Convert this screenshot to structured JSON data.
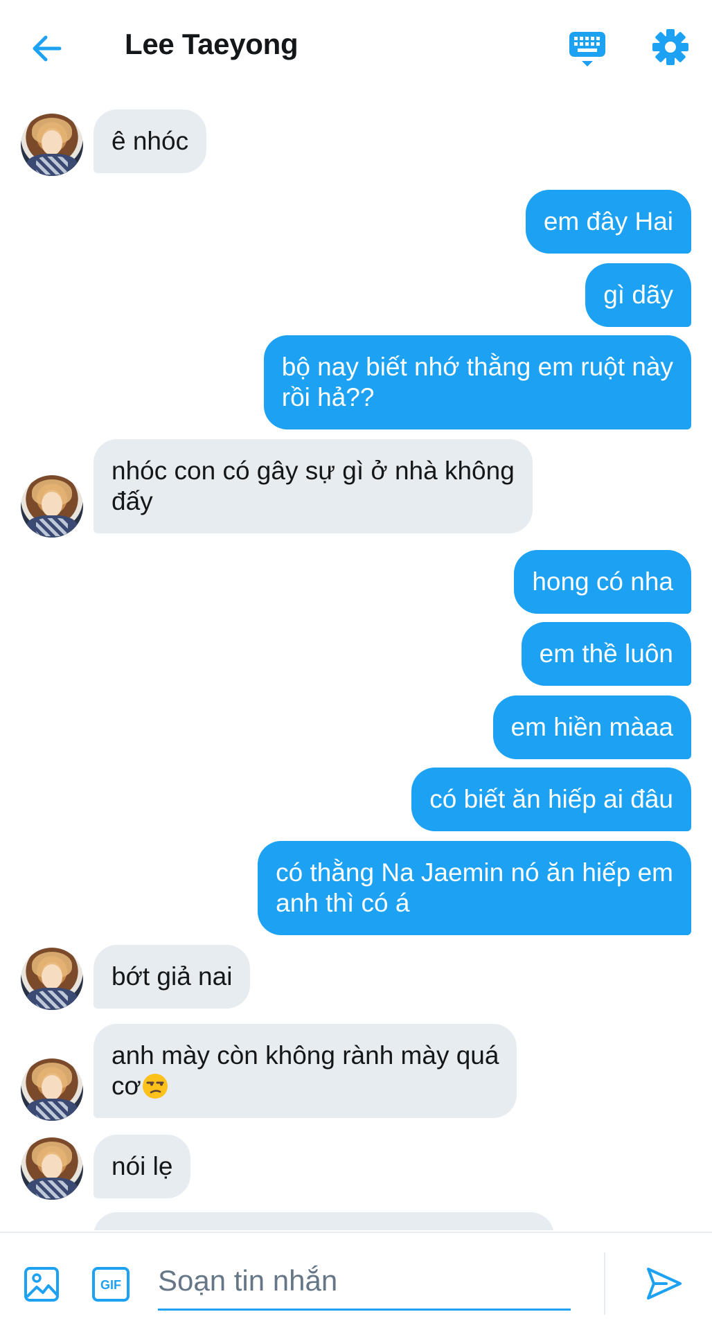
{
  "header": {
    "title": "Lee Taeyong",
    "back_icon": "arrow-left-icon",
    "keyboard_icon": "keyboard-icon",
    "settings_icon": "gear-icon"
  },
  "colors": {
    "accent": "#1da1f2",
    "incoming_bubble": "#e6ecf0",
    "text": "#14171a"
  },
  "messages": [
    {
      "side": "in",
      "text": "ê nhóc",
      "avatar": true
    },
    {
      "side": "out",
      "text": "em đây Hai"
    },
    {
      "side": "out",
      "text": "gì dãy"
    },
    {
      "side": "out",
      "text": "bộ nay biết nhớ thằng em ruột này\nrồi hả??"
    },
    {
      "side": "in",
      "text": "nhóc con có gây sự gì ở nhà không\nđấy",
      "avatar": true
    },
    {
      "side": "out",
      "text": "hong có nha"
    },
    {
      "side": "out",
      "text": "em thề luôn"
    },
    {
      "side": "out",
      "text": "em hiền màaa"
    },
    {
      "side": "out",
      "text": "có biết ăn hiếp ai đâu"
    },
    {
      "side": "out",
      "text": "có thằng Na Jaemin nó ăn hiếp em\nanh thì có á"
    },
    {
      "side": "in",
      "text": "bớt giả nai",
      "avatar": true
    },
    {
      "side": "in",
      "text": "anh mày còn không rành mày quá\ncơ",
      "avatar": true,
      "emoji": "unamused-face"
    },
    {
      "side": "in",
      "text": "nói lẹ",
      "avatar": true
    }
  ],
  "composer": {
    "placeholder": "Soạn tin nhắn",
    "image_icon": "image-icon",
    "gif_label": "GIF",
    "send_icon": "send-icon"
  }
}
